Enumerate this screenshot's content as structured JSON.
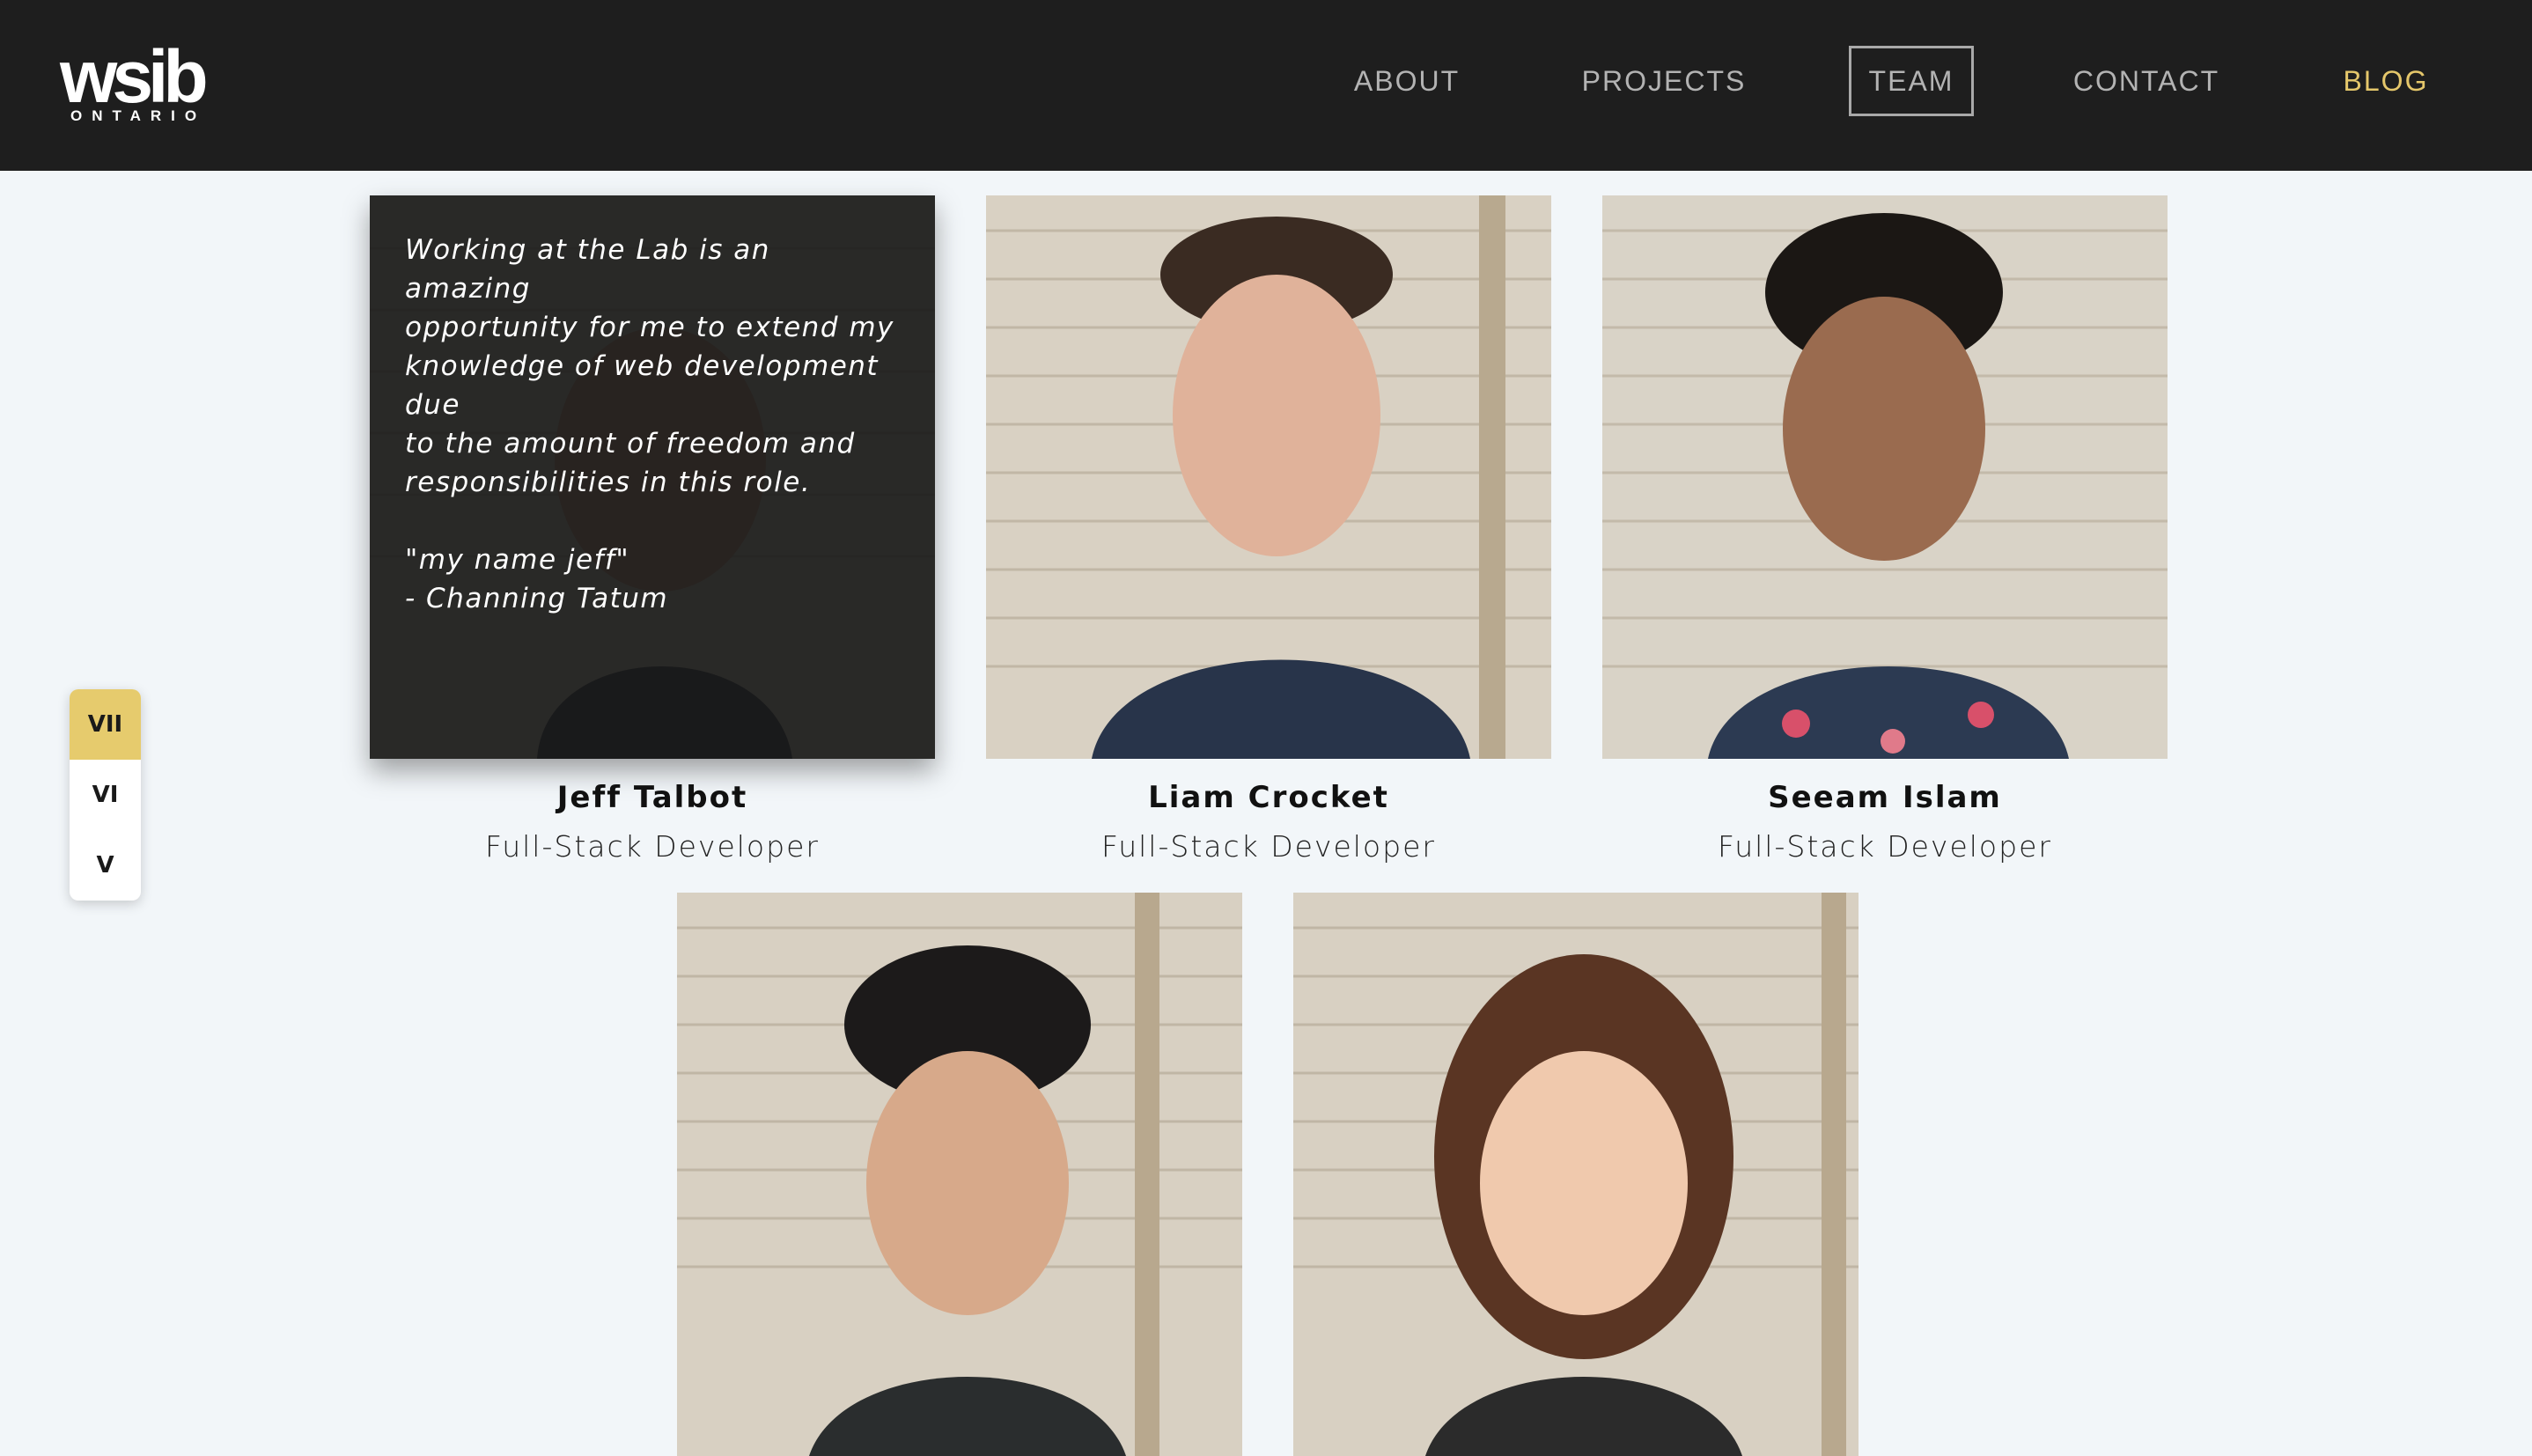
{
  "header": {
    "logo_word": "wsib",
    "logo_sub": "ONTARIO",
    "nav": {
      "about": "ABOUT",
      "projects": "PROJECTS",
      "team": "TEAM",
      "contact": "CONTACT",
      "blog": "BLOG"
    },
    "active_nav": "TEAM",
    "accent_color": "#e5c76b"
  },
  "year_selector": {
    "items": [
      "VII",
      "VI",
      "V"
    ],
    "selected": "VII"
  },
  "team": [
    {
      "name": "Jeff Talbot",
      "role": "Full-Stack Developer",
      "quote_lines": [
        "Working at the Lab is an amazing",
        "opportunity for me to extend my",
        "knowledge of web development due",
        "to the amount of freedom and",
        "responsibilities in this role."
      ],
      "quote_extra": [
        "\"my name jeff\"",
        "- Channing Tatum"
      ]
    },
    {
      "name": "Liam Crocket",
      "role": "Full-Stack Developer"
    },
    {
      "name": "Seeam Islam",
      "role": "Full-Stack Developer"
    },
    {
      "name": "",
      "role": ""
    },
    {
      "name": "",
      "role": ""
    }
  ]
}
